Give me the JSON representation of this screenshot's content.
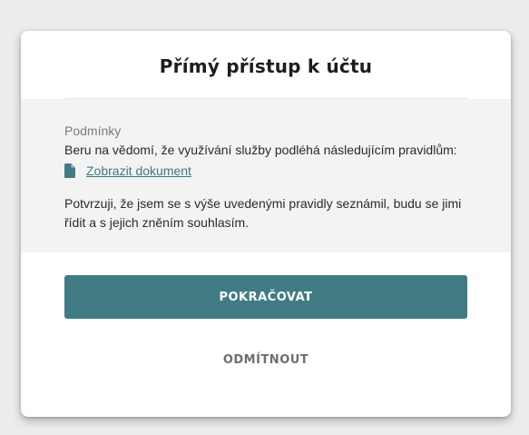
{
  "dialog": {
    "title": "Přímý přístup k účtu"
  },
  "terms": {
    "heading": "Podmínky",
    "text": "Beru na vědomí, že využívání služby podléhá následujícím pravidlům:",
    "document_link": "Zobrazit dokument",
    "document_icon": "document-icon",
    "confirmation": "Potvrzuji, že jsem se s výše uvedenými pravidly seznámil, budu se jimi řídit a s jejich zněním souhlasím."
  },
  "actions": {
    "continue_label": "POKRAČOVAT",
    "reject_label": "ODMÍTNOUT"
  },
  "colors": {
    "accent": "#417c84",
    "link": "#3c7a84",
    "panel_background": "#f3f3f3",
    "page_background": "#ececec"
  }
}
